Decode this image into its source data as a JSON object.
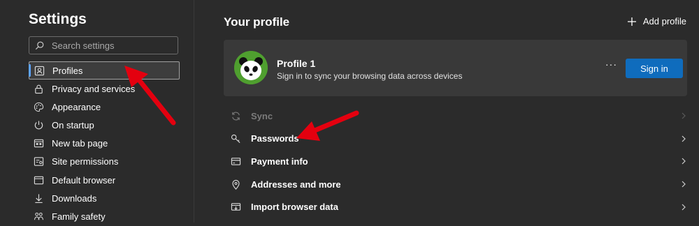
{
  "sidebar": {
    "title": "Settings",
    "search_placeholder": "Search settings",
    "items": [
      {
        "label": "Profiles",
        "icon": "profile-icon",
        "selected": true
      },
      {
        "label": "Privacy and services",
        "icon": "lock-icon"
      },
      {
        "label": "Appearance",
        "icon": "palette-icon"
      },
      {
        "label": "On startup",
        "icon": "power-icon"
      },
      {
        "label": "New tab page",
        "icon": "new-tab-icon"
      },
      {
        "label": "Site permissions",
        "icon": "site-permissions-icon"
      },
      {
        "label": "Default browser",
        "icon": "browser-icon"
      },
      {
        "label": "Downloads",
        "icon": "download-icon"
      },
      {
        "label": "Family safety",
        "icon": "family-icon"
      }
    ]
  },
  "main": {
    "title": "Your profile",
    "add_profile_label": "Add profile",
    "profile": {
      "name": "Profile 1",
      "subtitle": "Sign in to sync your browsing data across devices",
      "more_label": "···",
      "signin_label": "Sign in"
    },
    "list": [
      {
        "label": "Sync",
        "icon": "sync-icon",
        "disabled": true
      },
      {
        "label": "Passwords",
        "icon": "key-icon"
      },
      {
        "label": "Payment info",
        "icon": "card-icon"
      },
      {
        "label": "Addresses and more",
        "icon": "location-pin-icon"
      },
      {
        "label": "Import browser data",
        "icon": "import-icon"
      }
    ]
  },
  "colors": {
    "background": "#2b2b2b",
    "card": "#393939",
    "accent": "#0f6cbd",
    "annotation_arrow": "#e4000f"
  }
}
